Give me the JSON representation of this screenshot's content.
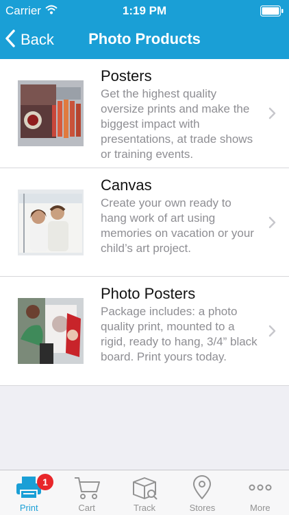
{
  "status_bar": {
    "carrier": "Carrier",
    "time": "1:19 PM",
    "wifi_icon": "wifi-icon",
    "battery_icon": "battery-icon"
  },
  "nav": {
    "back_label": "Back",
    "title": "Photo Products",
    "back_icon": "chevron-left-icon"
  },
  "products": [
    {
      "title": "Posters",
      "description": "Get the highest quality oversize prints and make the biggest impact with presentations, at trade shows or training events."
    },
    {
      "title": "Canvas",
      "description": "Create your own ready to hang work of art using memories on vacation or your child’s art project."
    },
    {
      "title": "Photo Posters",
      "description": "Package includes: a photo quality print, mounted to a rigid, ready to hang, 3/4” black board. Print yours today."
    }
  ],
  "tabs": [
    {
      "label": "Print",
      "icon": "printer-icon",
      "badge": "1",
      "active": true
    },
    {
      "label": "Cart",
      "icon": "cart-icon"
    },
    {
      "label": "Track",
      "icon": "package-icon"
    },
    {
      "label": "Stores",
      "icon": "location-pin-icon"
    },
    {
      "label": "More",
      "icon": "more-dots-icon"
    }
  ],
  "colors": {
    "header_blue": "#1a9fd6",
    "badge_red": "#e8262a",
    "desc_gray": "#8e8e93",
    "background_gray": "#efeff4"
  }
}
